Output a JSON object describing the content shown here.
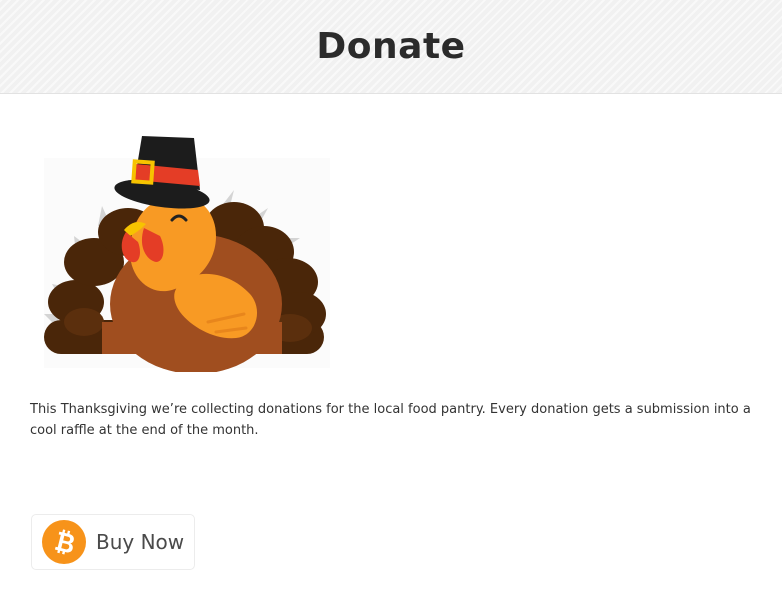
{
  "header": {
    "title": "Donate"
  },
  "content": {
    "image_icon": "thanksgiving-turkey-with-pilgrim-hat",
    "description": "This Thanksgiving we’re collecting donations for the local food pantry. Every donation gets a submission into a cool raffle at the end of the month."
  },
  "buy_button": {
    "icon": "bitcoin-icon",
    "icon_color": "#f7931a",
    "label": "Buy Now"
  }
}
